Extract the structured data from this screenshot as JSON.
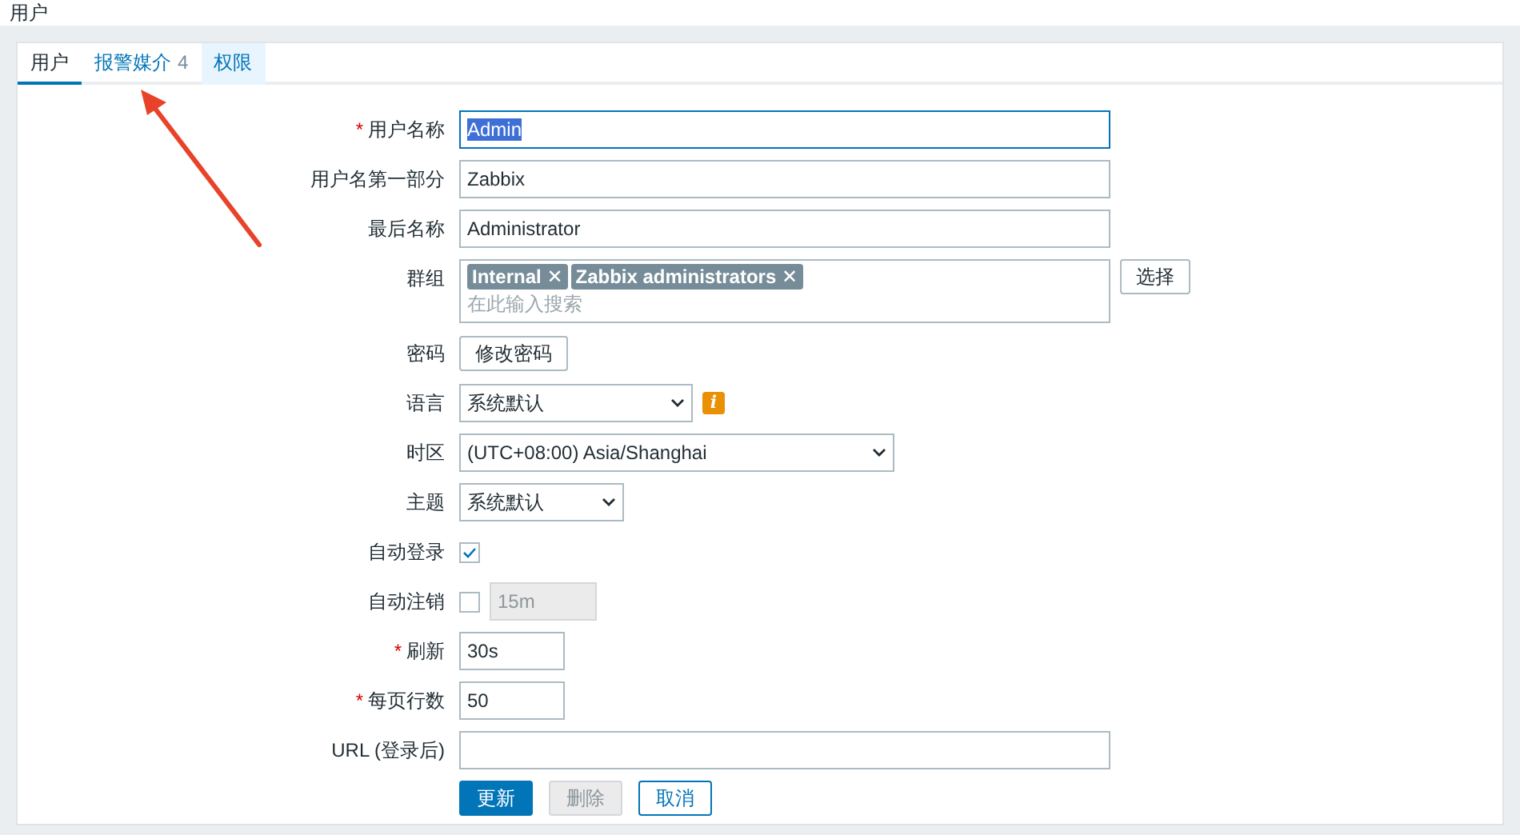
{
  "page_title": "用户",
  "tabs": [
    {
      "label": "用户",
      "selected": true,
      "hovered": false
    },
    {
      "label": "报警媒介",
      "count": "4",
      "selected": false,
      "hovered": false
    },
    {
      "label": "权限",
      "selected": false,
      "hovered": true
    }
  ],
  "form": {
    "fields": [
      {
        "kind": "text",
        "label": "用户名称",
        "required": true,
        "value": "Admin",
        "focused": true,
        "text_selected": true
      },
      {
        "kind": "text",
        "label": "用户名第一部分",
        "required": false,
        "value": "Zabbix",
        "focused": false,
        "text_selected": false
      },
      {
        "kind": "text",
        "label": "最后名称",
        "required": false,
        "value": "Administrator",
        "focused": false,
        "text_selected": false
      },
      {
        "kind": "multiselect",
        "label": "群组",
        "required": false,
        "tags": [
          "Internal",
          "Zabbix administrators"
        ],
        "remove_symbol": "✕",
        "placeholder": "在此输入搜索",
        "button": "选择"
      },
      {
        "kind": "button",
        "label": "密码",
        "required": false,
        "button": "修改密码"
      },
      {
        "kind": "select",
        "label": "语言",
        "required": false,
        "value": "系统默认",
        "info": "i"
      },
      {
        "kind": "select",
        "label": "时区",
        "required": false,
        "value": "(UTC+08:00) Asia/Shanghai"
      },
      {
        "kind": "select",
        "label": "主题",
        "required": false,
        "value": "系统默认"
      },
      {
        "kind": "checkbox",
        "label": "自动登录",
        "required": false,
        "checked": true
      },
      {
        "kind": "checkbox_interval",
        "label": "自动注销",
        "required": false,
        "checked": false,
        "value": "15m",
        "disabled": true
      },
      {
        "kind": "text",
        "label": "刷新",
        "required": true,
        "value": "30s",
        "focused": false,
        "text_selected": false
      },
      {
        "kind": "text",
        "label": "每页行数",
        "required": true,
        "value": "50",
        "focused": false,
        "text_selected": false
      },
      {
        "kind": "text",
        "label": "URL (登录后)",
        "required": false,
        "focused": false
      }
    ],
    "required_mark": "*",
    "buttons": [
      {
        "label": "更新",
        "kind": "primary",
        "disabled": false
      },
      {
        "label": "删除",
        "kind": "secondary",
        "disabled": true
      },
      {
        "label": "取消",
        "kind": "secondary",
        "disabled": false
      }
    ]
  }
}
